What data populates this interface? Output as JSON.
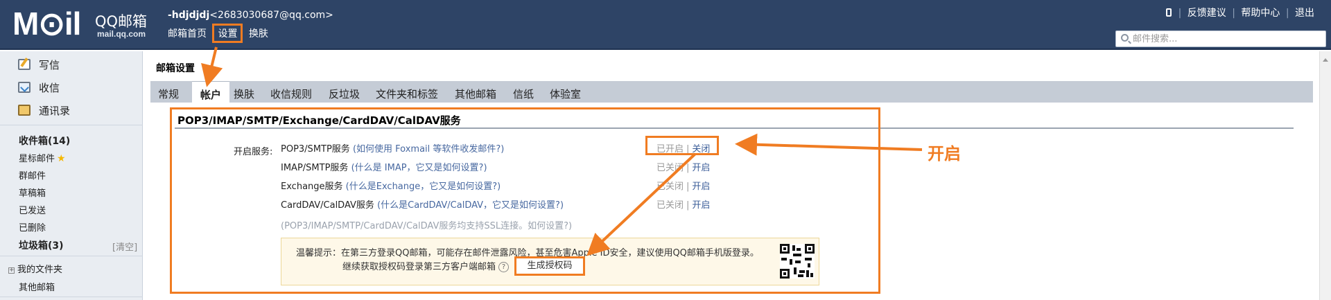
{
  "header": {
    "logo_text": "M⊙il",
    "logo_brand": "QQ邮箱",
    "logo_domain": "mail.qq.com",
    "user_nick": "-hdjdjdj",
    "user_email": "<2683030687@qq.com>",
    "nav": [
      "邮箱首页",
      "设置",
      "换肤"
    ],
    "top_links": [
      "反馈建议",
      "帮助中心",
      "退出"
    ],
    "search_placeholder": "邮件搜索..."
  },
  "sidebar": {
    "buttons": [
      "写信",
      "收信",
      "通讯录"
    ],
    "inbox": "收件箱(14)",
    "folders": [
      "星标邮件",
      "群邮件",
      "草稿箱",
      "已发送",
      "已删除"
    ],
    "junk": "垃圾箱(3)",
    "clear": "[清空]",
    "my_folders": "我的文件夹",
    "other_mail": "其他邮箱"
  },
  "main": {
    "title": "邮箱设置",
    "tabs": [
      "常规",
      "帐户",
      "换肤",
      "收信规则",
      "反垃圾",
      "文件夹和标签",
      "其他邮箱",
      "信纸",
      "体验室"
    ],
    "active_tab": "帐户",
    "section_title": "POP3/IMAP/SMTP/Exchange/CardDAV/CalDAV服务",
    "service_label": "开启服务:",
    "services": [
      {
        "name": "POP3/SMTP服务",
        "help": "(如何使用 Foxmail 等软件收发邮件?)",
        "status": "已开启",
        "action": "关闭"
      },
      {
        "name": "IMAP/SMTP服务",
        "help": "(什么是 IMAP，它又是如何设置?)",
        "status": "已关闭",
        "action": "开启"
      },
      {
        "name": "Exchange服务",
        "help": "(什么是Exchange，它又是如何设置?)",
        "status": "已关闭",
        "action": "开启"
      },
      {
        "name": "CardDAV/CalDAV服务",
        "help": "(什么是CardDAV/CalDAV，它又是如何设置?)",
        "status": "已关闭",
        "action": "开启"
      }
    ],
    "ssl_note": "(POP3/IMAP/SMTP/CardDAV/CalDAV服务均支持SSL连接。如何设置?)",
    "tip_line1": "温馨提示：在第三方登录QQ邮箱，可能存在邮件泄露风险，甚至危害Apple ID安全，建议使用QQ邮箱手机版登录。",
    "tip_line2": "继续获取授权码登录第三方客户端邮箱",
    "generate_btn": "生成授权码"
  },
  "annotation": {
    "label": "开启",
    "color": "#f07c22"
  },
  "colors": {
    "header_bg": "#2e4466",
    "accent": "#f07c22",
    "link": "#3b5d98"
  }
}
